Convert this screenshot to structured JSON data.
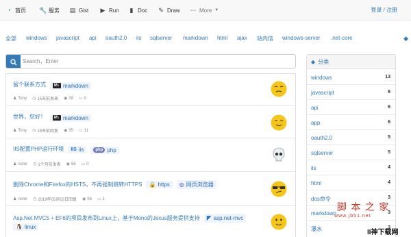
{
  "nav": {
    "items": [
      {
        "label": "首页",
        "icon": "home-icon"
      },
      {
        "label": "服务",
        "icon": "wrench-icon"
      },
      {
        "label": "Gist",
        "icon": "file-icon"
      },
      {
        "label": "Run",
        "icon": "play-icon"
      },
      {
        "label": "Doc",
        "icon": "book-icon"
      },
      {
        "label": "Draw",
        "icon": "pencil-icon"
      },
      {
        "label": "More",
        "icon": "dots-icon"
      }
    ],
    "login_label": "登录 / 注册"
  },
  "tags": [
    "全部",
    "windows",
    "javascript",
    "api",
    "oauth2.0",
    "iis",
    "sqlserver",
    "markdown",
    "html",
    "ajax",
    "站内信",
    "windows-server",
    ".net-core"
  ],
  "search": {
    "placeholder": "Search，Enter"
  },
  "posts": [
    {
      "title": "留个联系方式",
      "chips": [
        "markdown"
      ],
      "author": "Tony",
      "time": "15天前发表",
      "views": "39",
      "comments": "0"
    },
    {
      "title": "世界，您好！",
      "chips": [
        "markdown"
      ],
      "author": "Tony",
      "time": "18天前回复",
      "views": "35",
      "comments": "11"
    },
    {
      "title": "IIS配置PHP运行环境",
      "chips": [
        "iis",
        "php"
      ],
      "author": "netnr",
      "time": "1个月前发表",
      "views": "56",
      "comments": "0"
    },
    {
      "title": "删除Chrome和Firefox的HSTS，不再强制跳转HTTPS",
      "chips": [
        "https",
        "网页浏览器"
      ],
      "author": "netnr",
      "time": "2019年05月03日回复",
      "views": "96",
      "comments": "1"
    },
    {
      "title": "Asp.Net MVC5 + EF6的项目发布到Linux上，基于Mono的Jexus服务提供支持",
      "chips": [
        "asp.net-mvc",
        "linux"
      ],
      "author": "",
      "time": "",
      "views": "",
      "comments": ""
    }
  ],
  "sidebar": {
    "title": "分类",
    "categories": [
      {
        "name": "windows",
        "count": "13"
      },
      {
        "name": "javascript",
        "count": "8"
      },
      {
        "name": "api",
        "count": "6"
      },
      {
        "name": "app",
        "count": "6"
      },
      {
        "name": "oauth2.0",
        "count": "5"
      },
      {
        "name": "sqlserver",
        "count": "5"
      },
      {
        "name": "iis",
        "count": "4"
      },
      {
        "name": "html",
        "count": "4"
      },
      {
        "name": "dos命令",
        "count": "3"
      },
      {
        "name": "markdown",
        "count": "3"
      },
      {
        "name": "瀑水",
        "count": "3"
      }
    ]
  },
  "watermark": {
    "text": "脚 本 之 家",
    "url": "www.jb51.net",
    "brand": "II神下载网"
  },
  "colors": {
    "accent": "#337ab7",
    "brand_green": "#2a9d54"
  }
}
